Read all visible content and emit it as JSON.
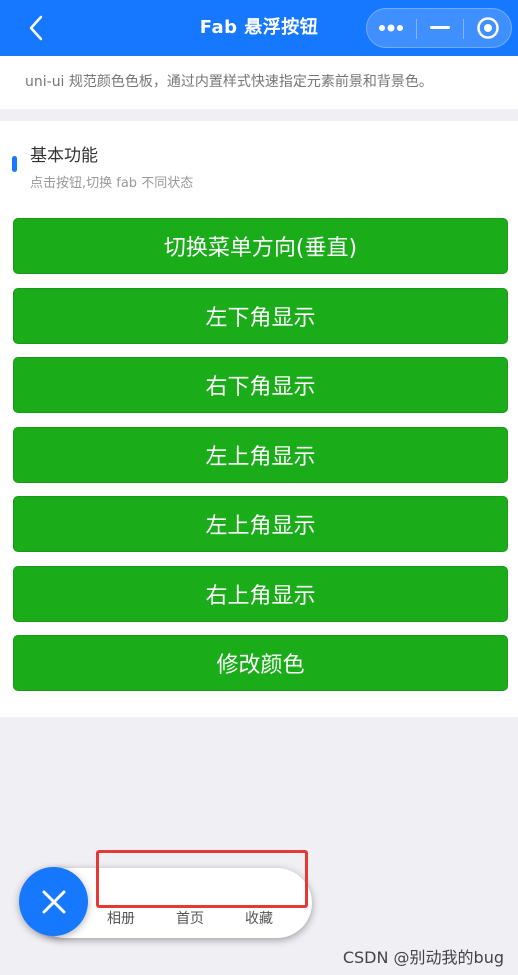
{
  "navbar": {
    "title": "Fab 悬浮按钮",
    "back_icon": "chevron-left-icon",
    "capsule": {
      "more_icon": "more-dots-icon",
      "minimize_icon": "minus-icon",
      "close_icon": "target-circle-icon"
    },
    "color": "#1677ff"
  },
  "intro": {
    "text": "uni-ui 规范颜色色板，通过内置样式快速指定元素前景和背景色。"
  },
  "section": {
    "title": "基本功能",
    "subtitle": "点击按钮,切换 fab 不同状态"
  },
  "buttons": [
    {
      "label": "切换菜单方向(垂直)"
    },
    {
      "label": "左下角显示"
    },
    {
      "label": "右下角显示"
    },
    {
      "label": "左上角显示"
    },
    {
      "label": "左上角显示"
    },
    {
      "label": "右上角显示"
    },
    {
      "label": "修改颜色"
    }
  ],
  "fab": {
    "main_icon": "close-icon",
    "items": [
      {
        "label": "相册"
      },
      {
        "label": "首页"
      },
      {
        "label": "收藏"
      }
    ],
    "color": "#1677ff"
  },
  "colors": {
    "button": "#1aad19",
    "highlight": "#e53935"
  },
  "watermark": {
    "text": "CSDN @别动我的bug"
  }
}
